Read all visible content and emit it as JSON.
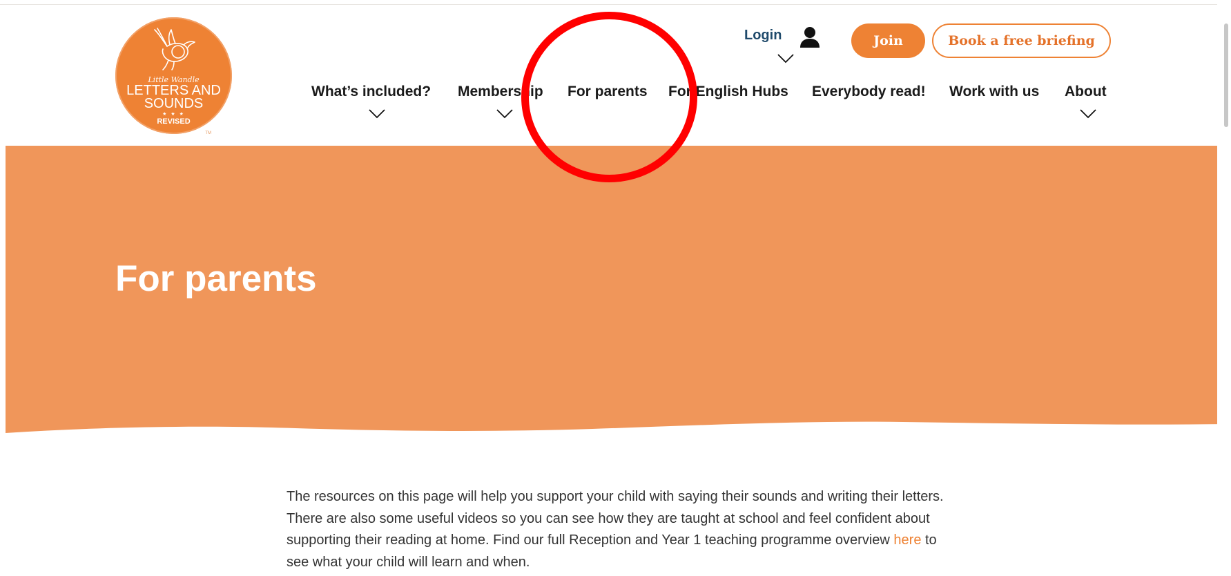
{
  "logo": {
    "script_text": "Little Wandle",
    "line1": "LETTERS AND",
    "line2": "SOUNDS",
    "stars": "★ ★ ★",
    "revised": "REVISED",
    "tm": "TM",
    "color": "#ee8234"
  },
  "header": {
    "login_label": "Login",
    "join_label": "Join",
    "briefing_label": "Book a free briefing"
  },
  "nav": {
    "items": [
      {
        "label": "What’s included?",
        "has_dropdown": true
      },
      {
        "label": "Membership",
        "has_dropdown": true
      },
      {
        "label": "For parents",
        "has_dropdown": false
      },
      {
        "label": "For English Hubs",
        "has_dropdown": false
      },
      {
        "label": "Everybody read!",
        "has_dropdown": false
      },
      {
        "label": "Work with us",
        "has_dropdown": false
      },
      {
        "label": "About",
        "has_dropdown": true
      }
    ]
  },
  "hero": {
    "title": "For parents",
    "background": "#f0965a"
  },
  "content": {
    "intro_before_link": "The resources on this page will help you support your child with saying their sounds and writing their letters. There are also some useful videos so you can see how they are taught at school and feel confident about supporting their reading at home. Find our full Reception and Year 1 teaching programme overview ",
    "link_text": "here",
    "intro_after_link": " to see what your child will learn and when."
  },
  "icons": {
    "user": "user-icon",
    "chevron": "chevron-down-icon",
    "bird": "bird-icon"
  },
  "colors": {
    "accent": "#ee8234",
    "login": "#1f4a6b",
    "annotation": "#ff0000"
  }
}
